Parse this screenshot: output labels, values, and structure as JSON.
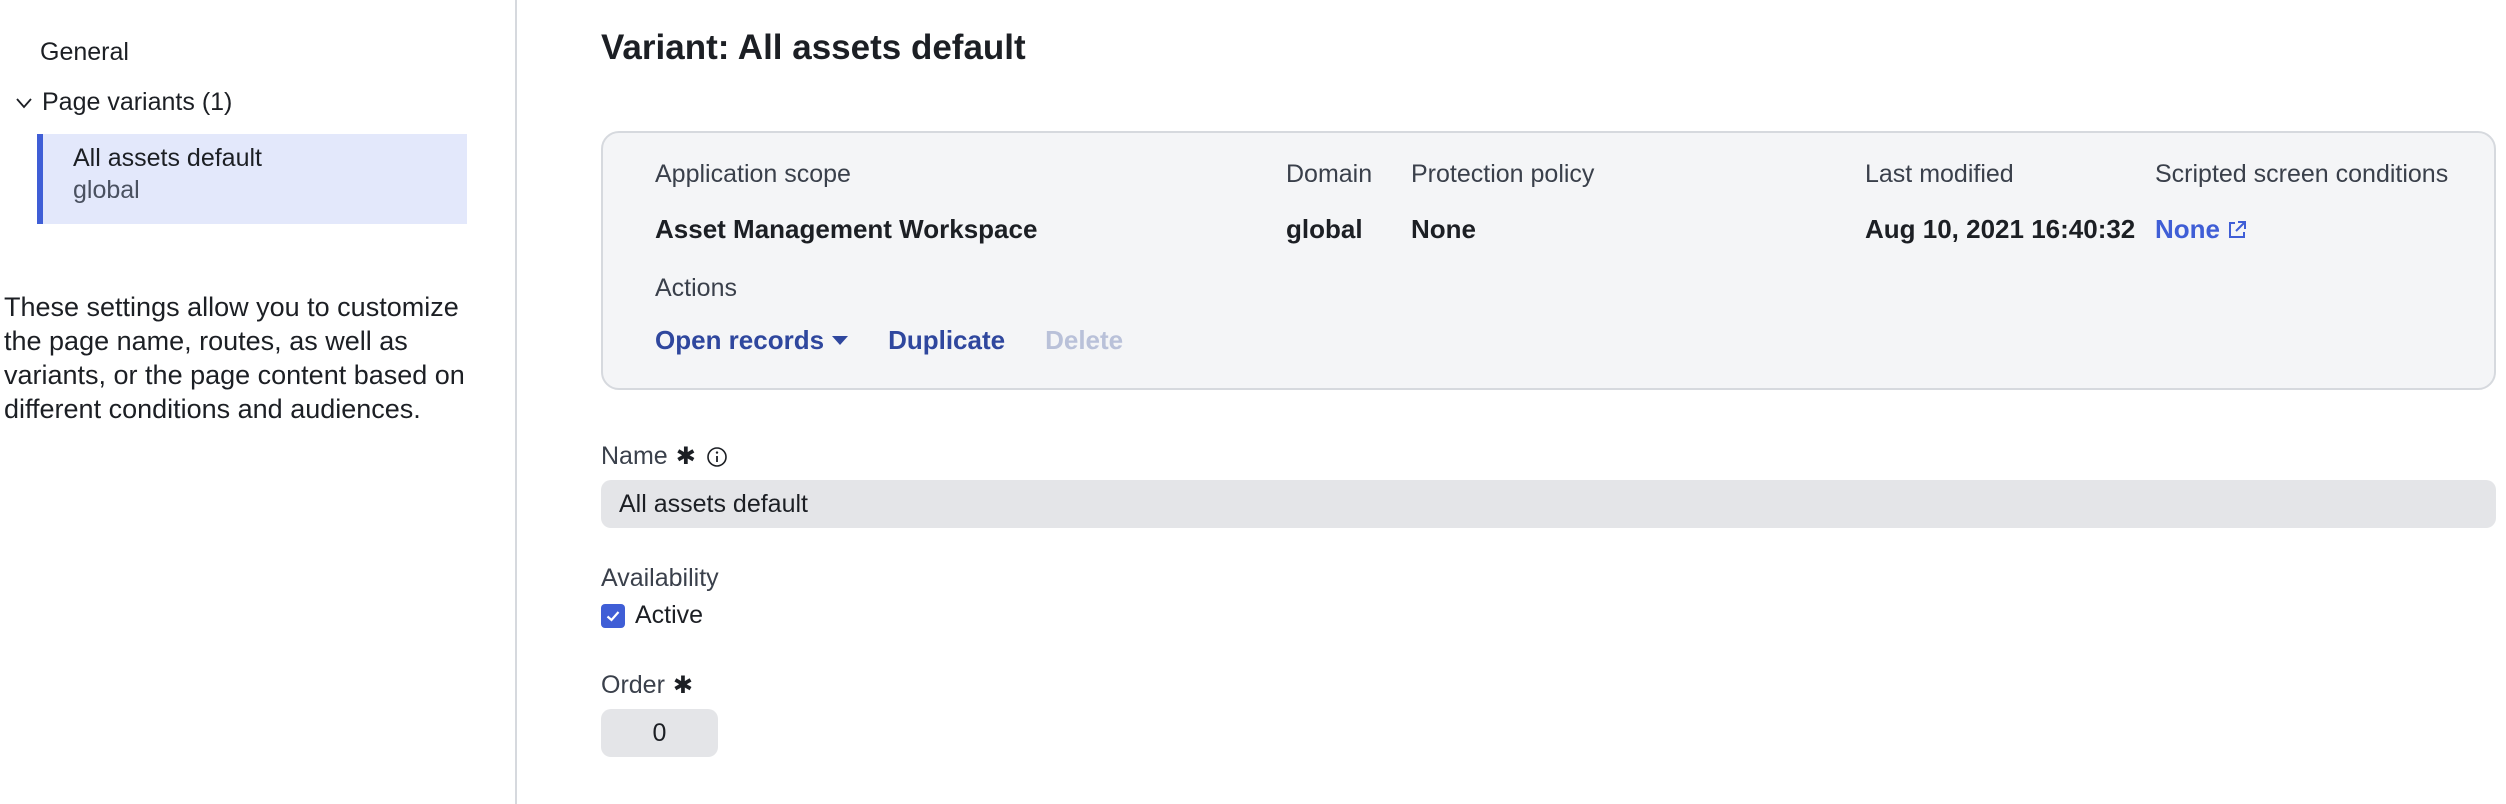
{
  "sidebar": {
    "general_label": "General",
    "group_label": "Page variants (1)",
    "variant": {
      "name": "All assets default",
      "scope": "global"
    },
    "help_text": "These settings allow you to customize the page name, routes, as well as variants, or the page content based on different conditions and audiences."
  },
  "main": {
    "title": "Variant: All assets default",
    "card": {
      "app_scope_label": "Application scope",
      "app_scope_value": "Asset Management Workspace",
      "domain_label": "Domain",
      "domain_value": "global",
      "protection_label": "Protection policy",
      "protection_value": "None",
      "modified_label": "Last modified",
      "modified_value": "Aug 10, 2021 16:40:32",
      "conditions_label": "Scripted screen conditions",
      "conditions_value": "None",
      "actions_label": "Actions",
      "actions": {
        "open_records": "Open records",
        "duplicate": "Duplicate",
        "delete": "Delete"
      }
    },
    "form": {
      "name_label": "Name",
      "name_value": "All assets default",
      "availability_label": "Availability",
      "active_label": "Active",
      "active_checked": true,
      "order_label": "Order",
      "order_value": "0"
    }
  },
  "colors": {
    "accent": "#3f5ed6",
    "action": "#2f479e",
    "disabled": "#b9c1d9",
    "selected_bg": "#e3e8fb",
    "card_bg": "#f4f5f7",
    "input_bg": "#e4e5e8"
  },
  "icons": {
    "chevron": "chevron-down-icon",
    "external": "external-link-icon",
    "info": "info-icon",
    "caret": "caret-down-icon",
    "check": "check-icon"
  }
}
